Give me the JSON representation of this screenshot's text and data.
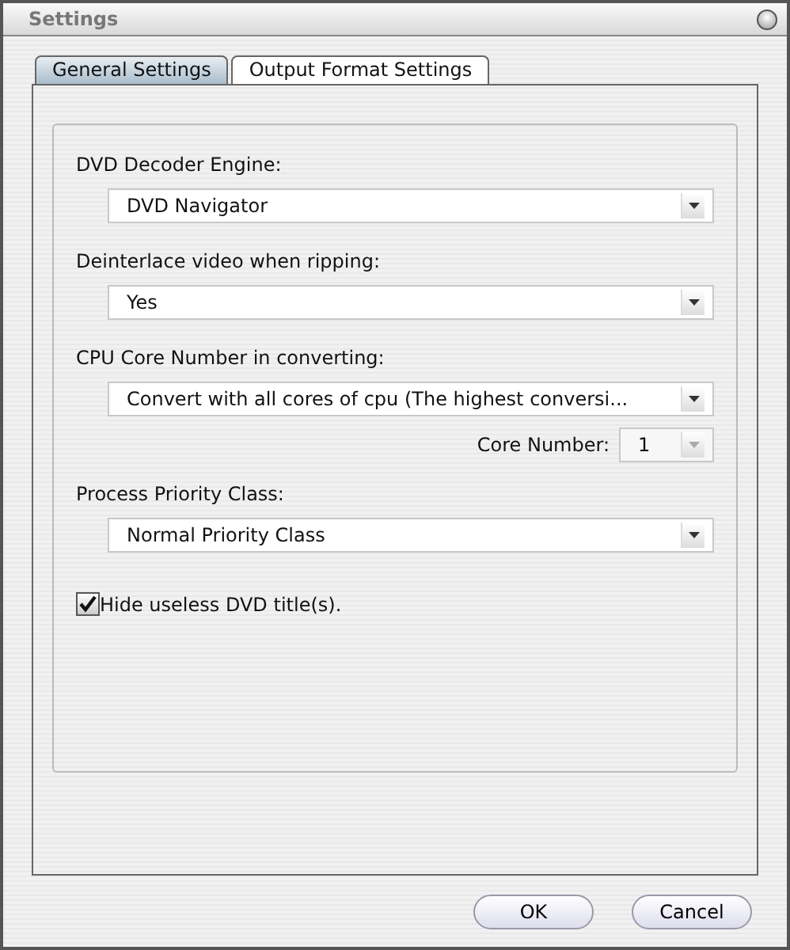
{
  "window": {
    "title": "Settings"
  },
  "tabs": [
    {
      "label": "General Settings",
      "selected": true
    },
    {
      "label": "Output Format Settings",
      "selected": false
    }
  ],
  "fields": [
    {
      "label": "DVD Decoder Engine:",
      "value": "DVD Navigator"
    },
    {
      "label": "Deinterlace video when ripping:",
      "value": "Yes"
    },
    {
      "label": "CPU Core Number in converting:",
      "value": "Convert with all cores of cpu (The highest conversi...",
      "sub": {
        "label": "Core Number:",
        "value": "1",
        "disabled": true
      }
    },
    {
      "label": "Process Priority Class:",
      "value": "Normal Priority Class"
    }
  ],
  "checkbox": {
    "label": "Hide useless DVD title(s).",
    "checked": true
  },
  "buttons": [
    "OK",
    "Cancel"
  ]
}
